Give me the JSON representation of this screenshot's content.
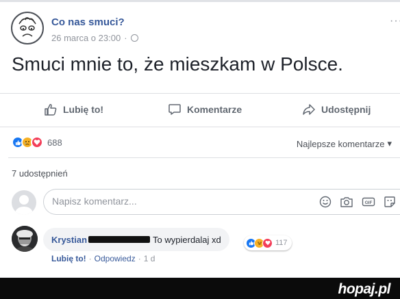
{
  "post": {
    "page_name": "Co nas smuci?",
    "date": "26 marca o 23:00",
    "separator": "·",
    "more": "···",
    "text": "Smuci mnie to, że mieszkam w Polsce."
  },
  "actions": {
    "like": "Lubię to!",
    "comment": "Komentarze",
    "share": "Udostępnij"
  },
  "reactions": {
    "icons": [
      "like",
      "sad",
      "love"
    ],
    "count": "688",
    "sort_label": "Najlepsze komentarze",
    "sort_arrow": "▾",
    "colors": {
      "like": "#1877f2",
      "sad": "#f7b125",
      "love": "#f33e58",
      "haha": "#f7b125"
    }
  },
  "shares": {
    "text": "7 udostępnień"
  },
  "comment_input": {
    "placeholder": "Napisz komentarz...",
    "icons": [
      "emoji-icon",
      "camera-icon",
      "gif-icon",
      "sticker-icon"
    ],
    "gif_label": "GIF"
  },
  "comment": {
    "author": "Krystian",
    "text": "To wypierdalaj xd",
    "reaction_icons": [
      "like",
      "haha",
      "love"
    ],
    "reaction_count": "117",
    "like_label": "Lubię to!",
    "dot": "·",
    "reply_label": "Odpowiedz",
    "time": "1 d"
  },
  "footer": {
    "brand": "hopaj.pl"
  }
}
